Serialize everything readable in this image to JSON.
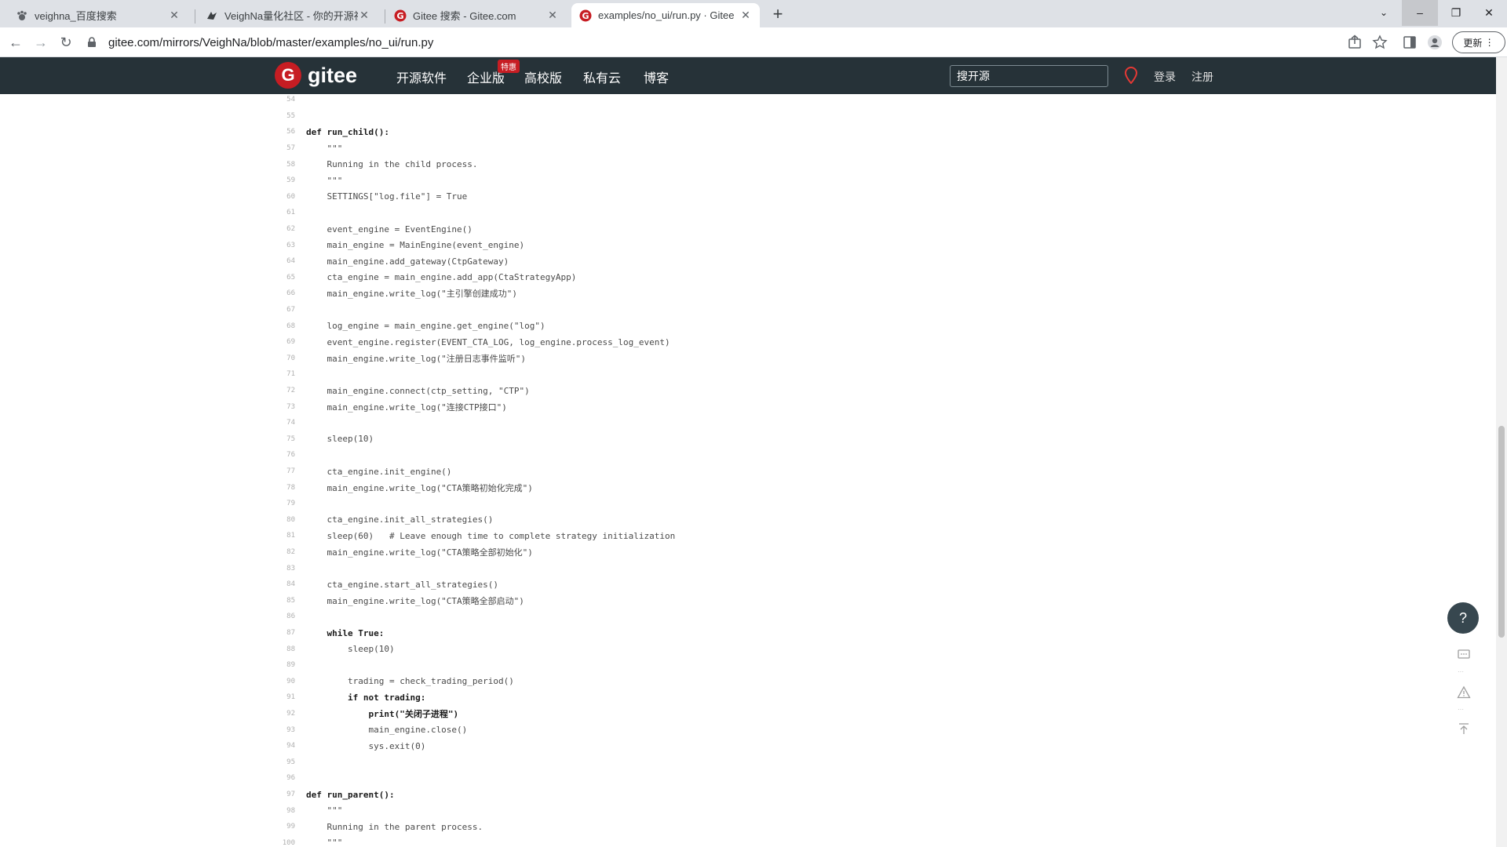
{
  "browser": {
    "tabs": [
      {
        "title": "veighna_百度搜索",
        "icon": "baidu-paw-icon"
      },
      {
        "title": "VeighNa量化社区 - 你的开源社",
        "icon": "veighna-icon"
      },
      {
        "title": "Gitee 搜索 - Gitee.com",
        "icon": "gitee-icon"
      },
      {
        "title": "examples/no_ui/run.py · Gitee",
        "icon": "gitee-icon"
      }
    ],
    "address": "gitee.com/mirrors/VeighNa/blob/master/examples/no_ui/run.py",
    "update_label": "更新"
  },
  "gitee": {
    "logo_text": "gitee",
    "nav": [
      "开源软件",
      "企业版",
      "高校版",
      "私有云",
      "博客"
    ],
    "enterprise_badge": "特惠",
    "search_placeholder": "搜开源",
    "login": "登录",
    "register": "注册"
  },
  "code": {
    "lines": [
      {
        "n": "54",
        "t": ""
      },
      {
        "n": "55",
        "t": ""
      },
      {
        "n": "56",
        "t": "def run_child():"
      },
      {
        "n": "57",
        "t": "    \"\"\""
      },
      {
        "n": "58",
        "t": "    Running in the child process."
      },
      {
        "n": "59",
        "t": "    \"\"\""
      },
      {
        "n": "60",
        "t": "    SETTINGS[\"log.file\"] = True"
      },
      {
        "n": "61",
        "t": ""
      },
      {
        "n": "62",
        "t": "    event_engine = EventEngine()"
      },
      {
        "n": "63",
        "t": "    main_engine = MainEngine(event_engine)"
      },
      {
        "n": "64",
        "t": "    main_engine.add_gateway(CtpGateway)"
      },
      {
        "n": "65",
        "t": "    cta_engine = main_engine.add_app(CtaStrategyApp)"
      },
      {
        "n": "66",
        "t": "    main_engine.write_log(\"主引擎创建成功\")"
      },
      {
        "n": "67",
        "t": ""
      },
      {
        "n": "68",
        "t": "    log_engine = main_engine.get_engine(\"log\")"
      },
      {
        "n": "69",
        "t": "    event_engine.register(EVENT_CTA_LOG, log_engine.process_log_event)"
      },
      {
        "n": "70",
        "t": "    main_engine.write_log(\"注册日志事件监听\")"
      },
      {
        "n": "71",
        "t": ""
      },
      {
        "n": "72",
        "t": "    main_engine.connect(ctp_setting, \"CTP\")"
      },
      {
        "n": "73",
        "t": "    main_engine.write_log(\"连接CTP接口\")"
      },
      {
        "n": "74",
        "t": ""
      },
      {
        "n": "75",
        "t": "    sleep(10)"
      },
      {
        "n": "76",
        "t": ""
      },
      {
        "n": "77",
        "t": "    cta_engine.init_engine()"
      },
      {
        "n": "78",
        "t": "    main_engine.write_log(\"CTA策略初始化完成\")"
      },
      {
        "n": "79",
        "t": ""
      },
      {
        "n": "80",
        "t": "    cta_engine.init_all_strategies()"
      },
      {
        "n": "81",
        "t": "    sleep(60)   # Leave enough time to complete strategy initialization"
      },
      {
        "n": "82",
        "t": "    main_engine.write_log(\"CTA策略全部初始化\")"
      },
      {
        "n": "83",
        "t": ""
      },
      {
        "n": "84",
        "t": "    cta_engine.start_all_strategies()"
      },
      {
        "n": "85",
        "t": "    main_engine.write_log(\"CTA策略全部启动\")"
      },
      {
        "n": "86",
        "t": ""
      },
      {
        "n": "87",
        "t": "    while True:"
      },
      {
        "n": "88",
        "t": "        sleep(10)"
      },
      {
        "n": "89",
        "t": ""
      },
      {
        "n": "90",
        "t": "        trading = check_trading_period()"
      },
      {
        "n": "91",
        "t": "        if not trading:"
      },
      {
        "n": "92",
        "t": "            print(\"关闭子进程\")"
      },
      {
        "n": "93",
        "t": "            main_engine.close()"
      },
      {
        "n": "94",
        "t": "            sys.exit(0)"
      },
      {
        "n": "95",
        "t": ""
      },
      {
        "n": "96",
        "t": ""
      },
      {
        "n": "97",
        "t": "def run_parent():"
      },
      {
        "n": "98",
        "t": "    \"\"\""
      },
      {
        "n": "99",
        "t": "    Running in the parent process."
      },
      {
        "n": "100",
        "t": "    \"\"\""
      }
    ]
  },
  "float_tools": {
    "help": "?"
  }
}
